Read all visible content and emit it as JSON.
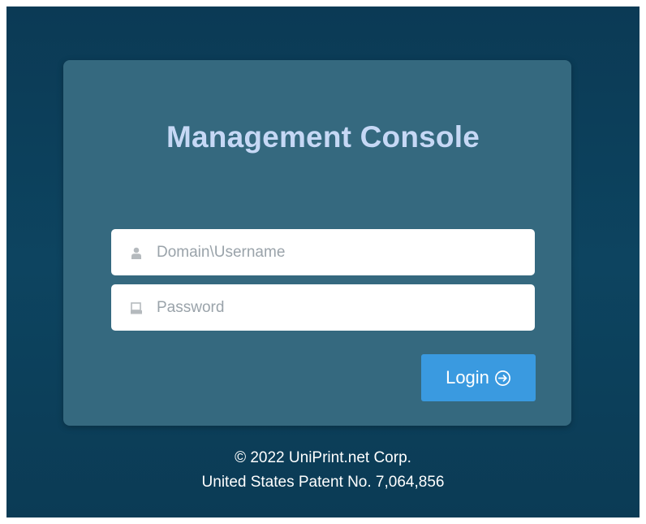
{
  "login": {
    "title": "Management Console",
    "username": {
      "value": "",
      "placeholder": "Domain\\Username",
      "icon": "user-icon"
    },
    "password": {
      "value": "",
      "placeholder": "Password",
      "icon": "lock-icon"
    },
    "submit_label": "Login",
    "submit_icon": "arrow-right-circle-icon"
  },
  "footer": {
    "copyright": "© 2022 UniPrint.net Corp.",
    "patent": "United States Patent No. 7,064,856"
  },
  "colors": {
    "background": "#0c3d57",
    "card": "#35697f",
    "title": "#c6d8f5",
    "button": "#3a9ae0"
  }
}
